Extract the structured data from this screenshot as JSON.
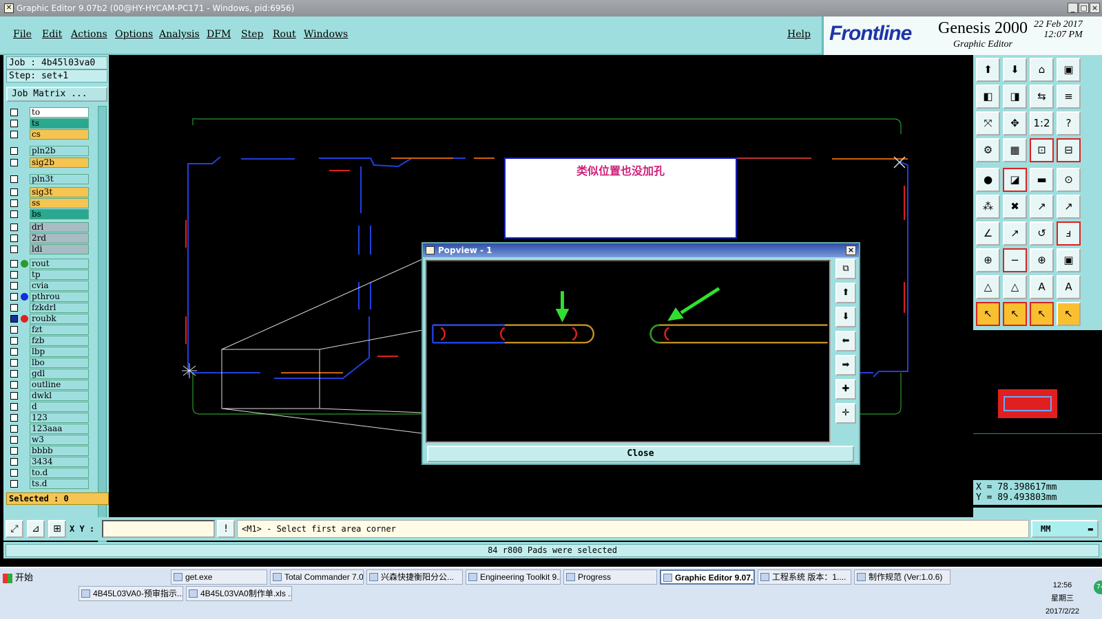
{
  "window": {
    "title": "Graphic Editor 9.07b2 (00@HY-HYCAM-PC171 - Windows, pid:6956)"
  },
  "menu": [
    "File",
    "Edit",
    "Actions",
    "Options",
    "Analysis",
    "DFM",
    "Step",
    "Rout",
    "Windows"
  ],
  "help_label": "Help",
  "brand": {
    "logo": "Frontline",
    "product": "Genesis 2000",
    "subtitle": "Graphic Editor",
    "date": "22 Feb 2017",
    "time": "12:07 PM"
  },
  "job": {
    "job_line": "Job : 4b45l03va0",
    "step_line": "Step: set+1",
    "matrix_button": "Job Matrix ..."
  },
  "layers": [
    {
      "name": "to",
      "color": "#ffffff",
      "dot": ""
    },
    {
      "name": "ts",
      "color": "#2aa890",
      "dot": ""
    },
    {
      "name": "cs",
      "color": "#f6c450",
      "dot": ""
    },
    {
      "name": "pln2b",
      "color": "#9fdede",
      "dot": ""
    },
    {
      "name": "sig2b",
      "color": "#f6c450",
      "dot": ""
    },
    {
      "name": "pln3t",
      "color": "#9fdede",
      "dot": ""
    },
    {
      "name": "sig3t",
      "color": "#f6c450",
      "dot": ""
    },
    {
      "name": "ss",
      "color": "#f6c450",
      "dot": ""
    },
    {
      "name": "bs",
      "color": "#2aa890",
      "dot": ""
    },
    {
      "name": "drl",
      "color": "#a8bcc4",
      "dot": ""
    },
    {
      "name": "2rd",
      "color": "#a8bcc4",
      "dot": ""
    },
    {
      "name": "ldi",
      "color": "#a8bcc4",
      "dot": ""
    },
    {
      "name": "rout",
      "color": "#9fdede",
      "dot": "#2a9a2a"
    },
    {
      "name": "tp",
      "color": "#9fdede",
      "dot": ""
    },
    {
      "name": "cvia",
      "color": "#9fdede",
      "dot": ""
    },
    {
      "name": "pthrou",
      "color": "#9fdede",
      "dot": "#1030e0"
    },
    {
      "name": "fzkdrl",
      "color": "#9fdede",
      "dot": ""
    },
    {
      "name": "roubk",
      "color": "#9fdede",
      "dot": "#e02020"
    },
    {
      "name": "fzt",
      "color": "#9fdede",
      "dot": ""
    },
    {
      "name": "fzb",
      "color": "#9fdede",
      "dot": ""
    },
    {
      "name": "lbp",
      "color": "#9fdede",
      "dot": ""
    },
    {
      "name": "lbo",
      "color": "#9fdede",
      "dot": ""
    },
    {
      "name": "gdl",
      "color": "#9fdede",
      "dot": ""
    },
    {
      "name": "outline",
      "color": "#9fdede",
      "dot": ""
    },
    {
      "name": "dwkl",
      "color": "#9fdede",
      "dot": ""
    },
    {
      "name": "d",
      "color": "#9fdede",
      "dot": ""
    },
    {
      "name": "123",
      "color": "#9fdede",
      "dot": ""
    },
    {
      "name": "123aaa",
      "color": "#9fdede",
      "dot": ""
    },
    {
      "name": "w3",
      "color": "#9fdede",
      "dot": ""
    },
    {
      "name": "bbbb",
      "color": "#9fdede",
      "dot": ""
    },
    {
      "name": "3434",
      "color": "#9fdede",
      "dot": ""
    },
    {
      "name": "to.d",
      "color": "#9fdede",
      "dot": ""
    },
    {
      "name": "ts.d",
      "color": "#9fdede",
      "dot": ""
    }
  ],
  "selected_label": "Selected : 0",
  "annotation": "类似位置也没加孔",
  "popview": {
    "title": "Popview - 1",
    "close_label": "Close"
  },
  "coords": {
    "x": "X = 78.398617mm",
    "y": "Y = 89.493803mm"
  },
  "cmd": {
    "xy_label": "X Y :",
    "message": "<M1> - Select first area corner",
    "units": "MM"
  },
  "status": "84 r800 Pads were selected",
  "taskbar": {
    "start": "开始",
    "tasks_row1": [
      "get.exe",
      "Total Commander 7.0...",
      "兴森快捷衡阳分公...",
      "Engineering Toolkit 9....",
      "Progress",
      "Graphic Editor 9.07...",
      "工程系统  版本：1....",
      "制作规范 (Ver:1.0.6)"
    ],
    "tasks_row2": [
      "4B45L03VA0-预审指示....",
      "4B45L03VA0制作单.xls ..."
    ],
    "clock": {
      "time": "12:56",
      "weekday": "星期三",
      "date": "2017/2/22"
    },
    "tray_badge": "74"
  },
  "colors": {
    "panel": "#9fdede",
    "canvas": "#000000",
    "accent_red": "#e02020",
    "brand_blue": "#1d35a8"
  }
}
